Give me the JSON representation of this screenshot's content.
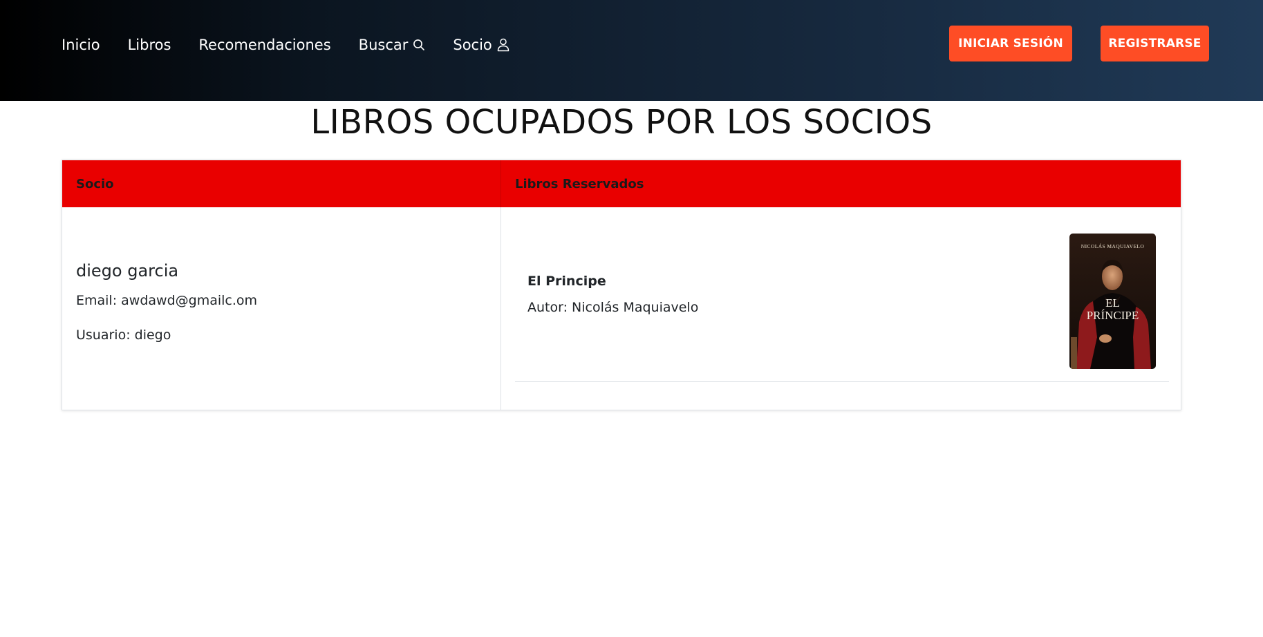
{
  "nav": {
    "links": [
      {
        "label": "Inicio"
      },
      {
        "label": "Libros"
      },
      {
        "label": "Recomendaciones"
      },
      {
        "label": "Buscar",
        "icon": "search-icon"
      },
      {
        "label": "Socio",
        "icon": "user-icon"
      }
    ],
    "login_label": "INICIAR SESIÓN",
    "register_label": "REGISTRARSE"
  },
  "page": {
    "title": "LIBROS OCUPADOS POR LOS SOCIOS"
  },
  "table": {
    "headers": [
      "Socio",
      "Libros Reservados"
    ],
    "rows": [
      {
        "socio": {
          "name": "diego garcia",
          "email": "Email: awdawd@gmailc.om",
          "usuario": "Usuario: diego"
        },
        "libros": [
          {
            "title": "El Principe",
            "author": "Autor: Nicolás Maquiavelo",
            "cover": {
              "top_text": "NICOLÁS MAQUIAVELO",
              "line1": "EL",
              "line2": "PRÍNCIPE"
            }
          }
        ]
      }
    ]
  },
  "colors": {
    "accent": "#fe4d25",
    "header_red": "#e90000",
    "nav_dark": "#000000",
    "nav_blue": "#203a57"
  }
}
